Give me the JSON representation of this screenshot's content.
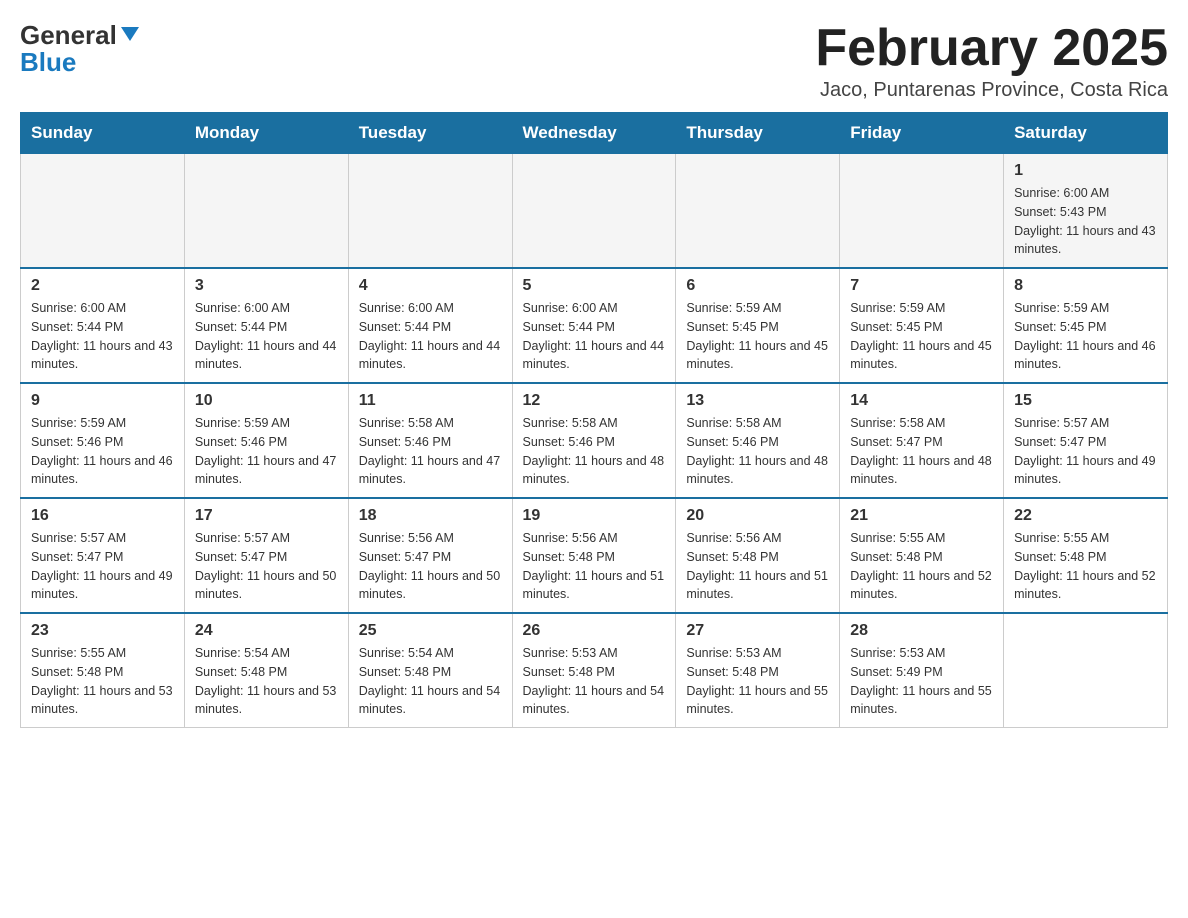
{
  "header": {
    "logo_general": "General",
    "logo_blue": "Blue",
    "month_title": "February 2025",
    "location": "Jaco, Puntarenas Province, Costa Rica"
  },
  "days_of_week": [
    "Sunday",
    "Monday",
    "Tuesday",
    "Wednesday",
    "Thursday",
    "Friday",
    "Saturday"
  ],
  "weeks": [
    {
      "cells": [
        {
          "day": "",
          "info": ""
        },
        {
          "day": "",
          "info": ""
        },
        {
          "day": "",
          "info": ""
        },
        {
          "day": "",
          "info": ""
        },
        {
          "day": "",
          "info": ""
        },
        {
          "day": "",
          "info": ""
        },
        {
          "day": "1",
          "info": "Sunrise: 6:00 AM\nSunset: 5:43 PM\nDaylight: 11 hours and 43 minutes."
        }
      ]
    },
    {
      "cells": [
        {
          "day": "2",
          "info": "Sunrise: 6:00 AM\nSunset: 5:44 PM\nDaylight: 11 hours and 43 minutes."
        },
        {
          "day": "3",
          "info": "Sunrise: 6:00 AM\nSunset: 5:44 PM\nDaylight: 11 hours and 44 minutes."
        },
        {
          "day": "4",
          "info": "Sunrise: 6:00 AM\nSunset: 5:44 PM\nDaylight: 11 hours and 44 minutes."
        },
        {
          "day": "5",
          "info": "Sunrise: 6:00 AM\nSunset: 5:44 PM\nDaylight: 11 hours and 44 minutes."
        },
        {
          "day": "6",
          "info": "Sunrise: 5:59 AM\nSunset: 5:45 PM\nDaylight: 11 hours and 45 minutes."
        },
        {
          "day": "7",
          "info": "Sunrise: 5:59 AM\nSunset: 5:45 PM\nDaylight: 11 hours and 45 minutes."
        },
        {
          "day": "8",
          "info": "Sunrise: 5:59 AM\nSunset: 5:45 PM\nDaylight: 11 hours and 46 minutes."
        }
      ]
    },
    {
      "cells": [
        {
          "day": "9",
          "info": "Sunrise: 5:59 AM\nSunset: 5:46 PM\nDaylight: 11 hours and 46 minutes."
        },
        {
          "day": "10",
          "info": "Sunrise: 5:59 AM\nSunset: 5:46 PM\nDaylight: 11 hours and 47 minutes."
        },
        {
          "day": "11",
          "info": "Sunrise: 5:58 AM\nSunset: 5:46 PM\nDaylight: 11 hours and 47 minutes."
        },
        {
          "day": "12",
          "info": "Sunrise: 5:58 AM\nSunset: 5:46 PM\nDaylight: 11 hours and 48 minutes."
        },
        {
          "day": "13",
          "info": "Sunrise: 5:58 AM\nSunset: 5:46 PM\nDaylight: 11 hours and 48 minutes."
        },
        {
          "day": "14",
          "info": "Sunrise: 5:58 AM\nSunset: 5:47 PM\nDaylight: 11 hours and 48 minutes."
        },
        {
          "day": "15",
          "info": "Sunrise: 5:57 AM\nSunset: 5:47 PM\nDaylight: 11 hours and 49 minutes."
        }
      ]
    },
    {
      "cells": [
        {
          "day": "16",
          "info": "Sunrise: 5:57 AM\nSunset: 5:47 PM\nDaylight: 11 hours and 49 minutes."
        },
        {
          "day": "17",
          "info": "Sunrise: 5:57 AM\nSunset: 5:47 PM\nDaylight: 11 hours and 50 minutes."
        },
        {
          "day": "18",
          "info": "Sunrise: 5:56 AM\nSunset: 5:47 PM\nDaylight: 11 hours and 50 minutes."
        },
        {
          "day": "19",
          "info": "Sunrise: 5:56 AM\nSunset: 5:48 PM\nDaylight: 11 hours and 51 minutes."
        },
        {
          "day": "20",
          "info": "Sunrise: 5:56 AM\nSunset: 5:48 PM\nDaylight: 11 hours and 51 minutes."
        },
        {
          "day": "21",
          "info": "Sunrise: 5:55 AM\nSunset: 5:48 PM\nDaylight: 11 hours and 52 minutes."
        },
        {
          "day": "22",
          "info": "Sunrise: 5:55 AM\nSunset: 5:48 PM\nDaylight: 11 hours and 52 minutes."
        }
      ]
    },
    {
      "cells": [
        {
          "day": "23",
          "info": "Sunrise: 5:55 AM\nSunset: 5:48 PM\nDaylight: 11 hours and 53 minutes."
        },
        {
          "day": "24",
          "info": "Sunrise: 5:54 AM\nSunset: 5:48 PM\nDaylight: 11 hours and 53 minutes."
        },
        {
          "day": "25",
          "info": "Sunrise: 5:54 AM\nSunset: 5:48 PM\nDaylight: 11 hours and 54 minutes."
        },
        {
          "day": "26",
          "info": "Sunrise: 5:53 AM\nSunset: 5:48 PM\nDaylight: 11 hours and 54 minutes."
        },
        {
          "day": "27",
          "info": "Sunrise: 5:53 AM\nSunset: 5:48 PM\nDaylight: 11 hours and 55 minutes."
        },
        {
          "day": "28",
          "info": "Sunrise: 5:53 AM\nSunset: 5:49 PM\nDaylight: 11 hours and 55 minutes."
        },
        {
          "day": "",
          "info": ""
        }
      ]
    }
  ]
}
